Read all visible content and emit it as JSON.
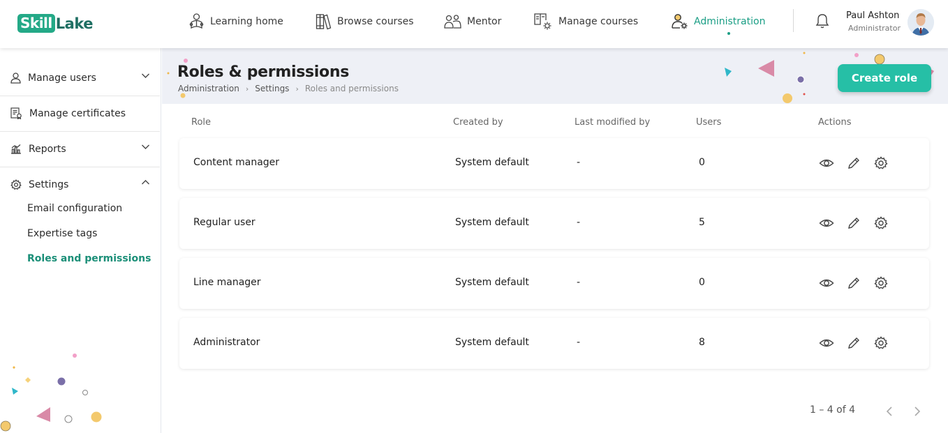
{
  "brand": {
    "logo_box": "Skill",
    "logo_rest": "Lake"
  },
  "nav": {
    "items": [
      {
        "label": "Learning home",
        "icon": "learning-home-icon"
      },
      {
        "label": "Browse courses",
        "icon": "books-icon"
      },
      {
        "label": "Mentor",
        "icon": "mentor-icon"
      },
      {
        "label": "Manage courses",
        "icon": "manage-courses-icon"
      },
      {
        "label": "Administration",
        "icon": "admin-user-gear-icon",
        "active": true
      }
    ]
  },
  "user": {
    "name": "Paul Ashton",
    "role": "Administrator"
  },
  "sidebar": {
    "items": [
      {
        "label": "Manage users",
        "icon": "user-icon",
        "expanded": false
      },
      {
        "label": "Manage certificates",
        "icon": "certificate-icon"
      },
      {
        "label": "Reports",
        "icon": "chart-icon",
        "expanded": false
      },
      {
        "label": "Settings",
        "icon": "gear-icon",
        "expanded": true
      }
    ],
    "settings_children": [
      {
        "label": "Email configuration"
      },
      {
        "label": "Expertise tags"
      },
      {
        "label": "Roles and permissions",
        "active": true
      }
    ]
  },
  "page": {
    "title": "Roles & permissions",
    "breadcrumb": [
      "Administration",
      "Settings",
      "Roles and permissions"
    ],
    "create_button": "Create role"
  },
  "table": {
    "columns": [
      "Role",
      "Created by",
      "Last modified by",
      "Users",
      "Actions"
    ],
    "rows": [
      {
        "role": "Content manager",
        "created_by": "System default",
        "modified_by": "-",
        "users": "0"
      },
      {
        "role": "Regular user",
        "created_by": "System default",
        "modified_by": "-",
        "users": "5"
      },
      {
        "role": "Line manager",
        "created_by": "System default",
        "modified_by": "-",
        "users": "0"
      },
      {
        "role": "Administrator",
        "created_by": "System default",
        "modified_by": "-",
        "users": "8"
      }
    ],
    "actions": [
      "eye-icon",
      "pencil-icon",
      "gear-icon"
    ]
  },
  "pagination": {
    "range": "1 – 4 of 4"
  },
  "colors": {
    "accent": "#1b9e85",
    "button": "#26bfa6",
    "header_band": "#eef0f6"
  }
}
